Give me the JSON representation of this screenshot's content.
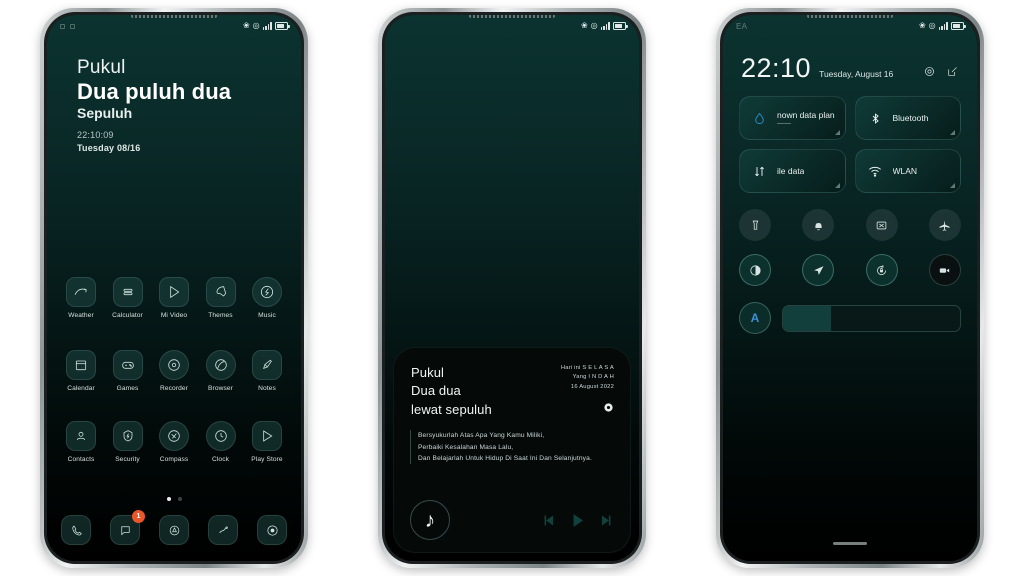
{
  "background_color": "#ffffff",
  "theme": {
    "accent": "#0b3330",
    "wallpaper_top": "#0b3330",
    "wallpaper_bottom": "#000000",
    "badge_color": "#e8562a",
    "auto_brightness_color": "#3e8fd6"
  },
  "status_bar": {
    "left_label": "EA",
    "icons": [
      "bluetooth-icon",
      "dnd-icon",
      "signal-icon",
      "battery-icon"
    ]
  },
  "phone1": {
    "clock_widget": {
      "line1": "Pukul",
      "line2": "Dua puluh dua",
      "line3": "Sepuluh",
      "time": "22:10:09",
      "date": "Tuesday 08/16"
    },
    "apps": [
      {
        "label": "Weather",
        "icon": "weather-icon"
      },
      {
        "label": "Calculator",
        "icon": "calculator-icon"
      },
      {
        "label": "Mi Video",
        "icon": "video-icon"
      },
      {
        "label": "Themes",
        "icon": "themes-icon"
      },
      {
        "label": "Music",
        "icon": "music-icon"
      },
      {
        "label": "Calendar",
        "icon": "calendar-icon"
      },
      {
        "label": "Games",
        "icon": "games-icon"
      },
      {
        "label": "Recorder",
        "icon": "recorder-icon"
      },
      {
        "label": "Browser",
        "icon": "browser-icon"
      },
      {
        "label": "Notes",
        "icon": "notes-icon"
      },
      {
        "label": "Contacts",
        "icon": "contacts-icon"
      },
      {
        "label": "Security",
        "icon": "security-icon"
      },
      {
        "label": "Compass",
        "icon": "compass-icon"
      },
      {
        "label": "Clock",
        "icon": "clock-icon"
      },
      {
        "label": "Play Store",
        "icon": "play-store-icon"
      }
    ],
    "pager": {
      "pages": 2,
      "current": 1
    },
    "dock": [
      {
        "name": "phone",
        "icon": "phone-icon",
        "badge": ""
      },
      {
        "name": "messages",
        "icon": "message-icon",
        "badge": "1"
      },
      {
        "name": "app-vault",
        "icon": "app-vault-icon",
        "badge": ""
      },
      {
        "name": "gallery",
        "icon": "gallery-icon",
        "badge": ""
      },
      {
        "name": "camera",
        "icon": "camera-icon",
        "badge": ""
      }
    ]
  },
  "phone2": {
    "lyrics_panel": {
      "line1": "Pukul",
      "line2": "Dua dua",
      "line3": "lewat sepuluh",
      "meta1": "Hari ini S E L A S A",
      "meta2": "Yang I N D A H",
      "meta3": "16 August 2022",
      "quote1": "Bersyukurlah Atas Apa Yang Kamu Miliki,",
      "quote2": "Perbaiki Kesalahan Masa Lalu,",
      "quote3": "Dan Belajarlah Untuk Hidup Di Saat Ini Dan Selanjutnya.",
      "note_glyph": "♪",
      "controls": [
        "previous-track-button",
        "play-button",
        "next-track-button"
      ]
    }
  },
  "phone3": {
    "header": {
      "time": "22:10",
      "date": "Tuesday, August 16",
      "icons": [
        "settings-icon",
        "edit-icon"
      ]
    },
    "tiles": [
      {
        "label": "nown data plan",
        "sub": "——",
        "icon": "data-plan-icon"
      },
      {
        "label": "Bluetooth",
        "sub": "",
        "icon": "bluetooth-icon"
      },
      {
        "label": "ile data",
        "sub": "",
        "icon": "mobile-data-icon"
      },
      {
        "label": "WLAN",
        "sub": "",
        "icon": "wlan-icon"
      }
    ],
    "toggles_row1": [
      {
        "name": "flashlight",
        "icon": "flashlight-icon",
        "state": "off"
      },
      {
        "name": "ringer",
        "icon": "bell-icon",
        "state": "off"
      },
      {
        "name": "cast",
        "icon": "cast-icon",
        "state": "off"
      },
      {
        "name": "airplane-mode",
        "icon": "airplane-icon",
        "state": "off"
      }
    ],
    "toggles_row2": [
      {
        "name": "dark-mode",
        "icon": "contrast-icon",
        "state": "on"
      },
      {
        "name": "location",
        "icon": "location-icon",
        "state": "on"
      },
      {
        "name": "rotation-lock",
        "icon": "rotation-lock-icon",
        "state": "on"
      },
      {
        "name": "screen-recorder",
        "icon": "video-camera-icon",
        "state": "dark"
      }
    ],
    "brightness": {
      "auto_label": "A",
      "value_percent": 27
    }
  }
}
